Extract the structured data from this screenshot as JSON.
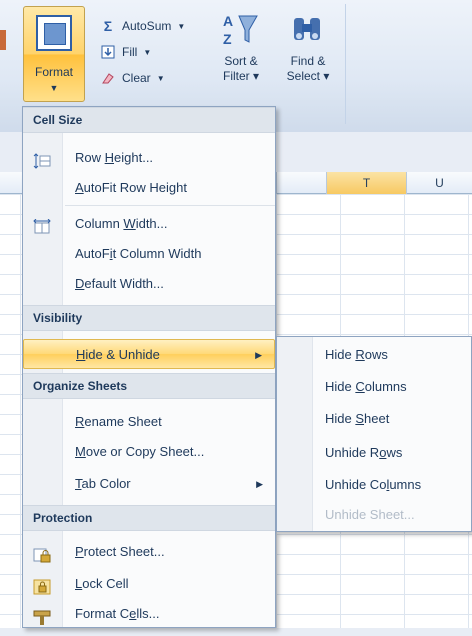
{
  "ribbon": {
    "format_label": "Format",
    "autosum_label": "AutoSum",
    "fill_label": "Fill",
    "clear_label": "Clear",
    "sort_label_1": "Sort &",
    "sort_label_2": "Filter",
    "find_label_1": "Find &",
    "find_label_2": "Select"
  },
  "columns": [
    "T",
    "U"
  ],
  "menu": {
    "sections": {
      "cell_size": "Cell Size",
      "visibility": "Visibility",
      "organize": "Organize Sheets",
      "protection": "Protection"
    },
    "items": {
      "row_height": {
        "pre": "Row ",
        "u": "H",
        "post": "eight..."
      },
      "autofit_row_height": {
        "pre": "",
        "u": "A",
        "post": "utoFit Row Height"
      },
      "column_width": {
        "pre": "Column ",
        "u": "W",
        "post": "idth..."
      },
      "autofit_column_width": {
        "pre": "AutoF",
        "u": "i",
        "post": "t Column Width"
      },
      "default_width": {
        "pre": "",
        "u": "D",
        "post": "efault Width..."
      },
      "hide_unhide": {
        "pre": "",
        "u": "H",
        "post": "ide & Unhide"
      },
      "rename_sheet": {
        "pre": "",
        "u": "R",
        "post": "ename Sheet"
      },
      "move_copy": {
        "pre": "",
        "u": "M",
        "post": "ove or Copy Sheet..."
      },
      "tab_color": {
        "pre": "",
        "u": "T",
        "post": "ab Color"
      },
      "protect_sheet": {
        "pre": "",
        "u": "P",
        "post": "rotect Sheet..."
      },
      "lock_cell": {
        "pre": "",
        "u": "L",
        "post": "ock Cell"
      },
      "format_cells": {
        "pre": "Format C",
        "u": "e",
        "post": "lls..."
      }
    }
  },
  "submenu": {
    "hide_rows": {
      "pre": "Hide ",
      "u": "R",
      "post": "ows"
    },
    "hide_columns": {
      "pre": "Hide ",
      "u": "C",
      "post": "olumns"
    },
    "hide_sheet": {
      "pre": "Hide ",
      "u": "S",
      "post": "heet"
    },
    "unhide_rows": {
      "pre": "Unhide R",
      "u": "o",
      "post": "ws"
    },
    "unhide_columns": {
      "pre": "Unhide Co",
      "u": "l",
      "post": "umns"
    },
    "unhide_sheet": {
      "pre": "Unhide Sheet...",
      "u": "",
      "post": ""
    }
  },
  "colors": {
    "accent": "#2f5fa6",
    "hover": "#ffd978",
    "menu_text": "#1e395b"
  },
  "icons": [
    "row-height-icon",
    "column-width-icon",
    "protect-sheet-icon",
    "lock-cell-icon",
    "format-cells-icon",
    "autosum-icon",
    "fill-icon",
    "clear-icon",
    "sort-filter-icon",
    "find-select-icon"
  ]
}
